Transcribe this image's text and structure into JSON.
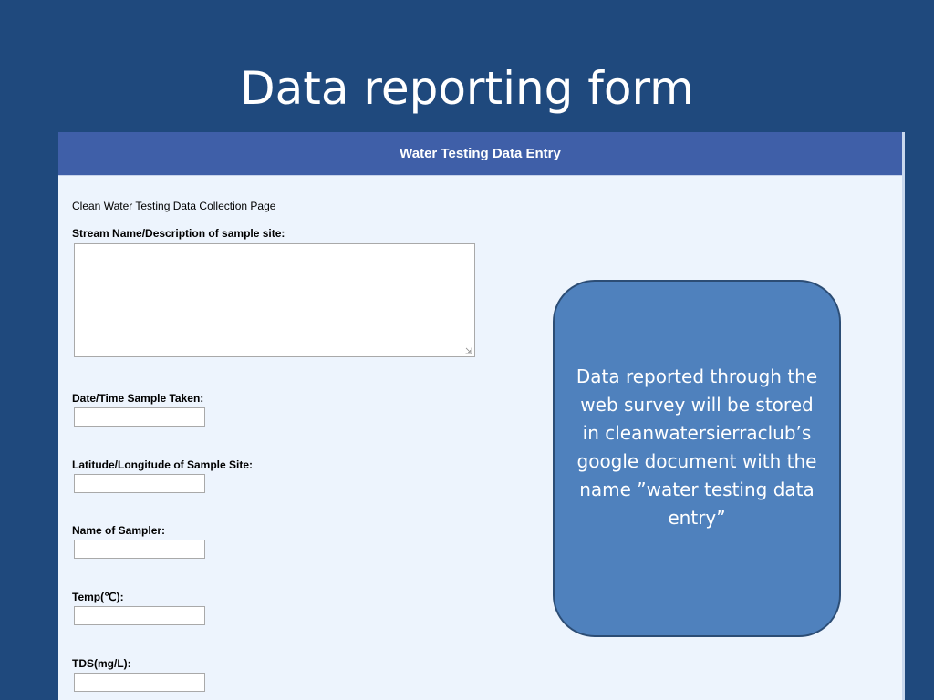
{
  "slide": {
    "title": "Data reporting form",
    "background_color": "#1f497d"
  },
  "form": {
    "header_title": "Water Testing Data Entry",
    "header_color": "#3f5fa8",
    "intro_text": "Clean Water Testing Data Collection Page",
    "fields": {
      "stream_name_label": "Stream Name/Description of sample site:",
      "stream_name_value": "",
      "date_time_label": "Date/Time Sample Taken:",
      "date_time_value": "",
      "lat_long_label": "Latitude/Longitude of Sample Site:",
      "lat_long_value": "",
      "sampler_label": "Name of Sampler:",
      "sampler_value": "",
      "temp_label": "Temp(℃):",
      "temp_value": "",
      "tds_label": "TDS(mg/L):",
      "tds_value": ""
    }
  },
  "callout": {
    "text": "Data reported through the web survey will be stored in cleanwatersierraclub’s google document with the name ”water testing data entry”",
    "fill_color": "#4f81bd"
  }
}
